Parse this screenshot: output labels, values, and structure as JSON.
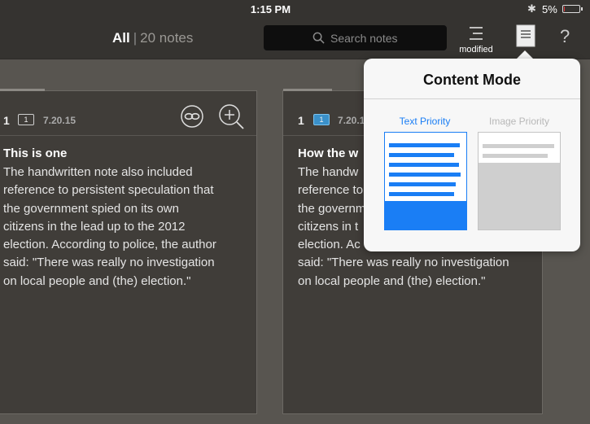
{
  "status": {
    "time": "1:15 PM",
    "battery_text": "5%",
    "battery_level": 0.05,
    "battery_color": "#e3353b"
  },
  "nav": {
    "all_label": "All",
    "separator": "|",
    "count_label": "20 notes",
    "search_placeholder": "Search notes",
    "sort_label": "modified",
    "help_label": "?"
  },
  "cards": [
    {
      "number": "1",
      "badge": "1",
      "date": "7.20.15",
      "title": "This is one",
      "body": [
        "The handwritten note also included",
        "reference to persistent speculation that",
        "the government spied on its own",
        "citizens in the lead up to the 2012",
        "election. According to police, the author",
        "said: \"There was really no investigation",
        "on local people and (the) election.\""
      ]
    },
    {
      "number": "1",
      "badge": "1",
      "date": "7.20.1",
      "title": "How the w",
      "body": [
        "The handw",
        "reference to",
        "the governm",
        "citizens in t",
        "election. Ac",
        "said: \"There was really no investigation",
        "on local people and (the) election.\""
      ]
    }
  ],
  "popover": {
    "title": "Content Mode",
    "options": [
      {
        "label": "Text Priority",
        "selected": true,
        "color": "#1a7ef5"
      },
      {
        "label": "Image Priority",
        "selected": false,
        "color": "#b8b8b8"
      }
    ]
  },
  "colors": {
    "accent": "#1a7ef5",
    "card_bg": "#403d39",
    "background": "#585550"
  }
}
